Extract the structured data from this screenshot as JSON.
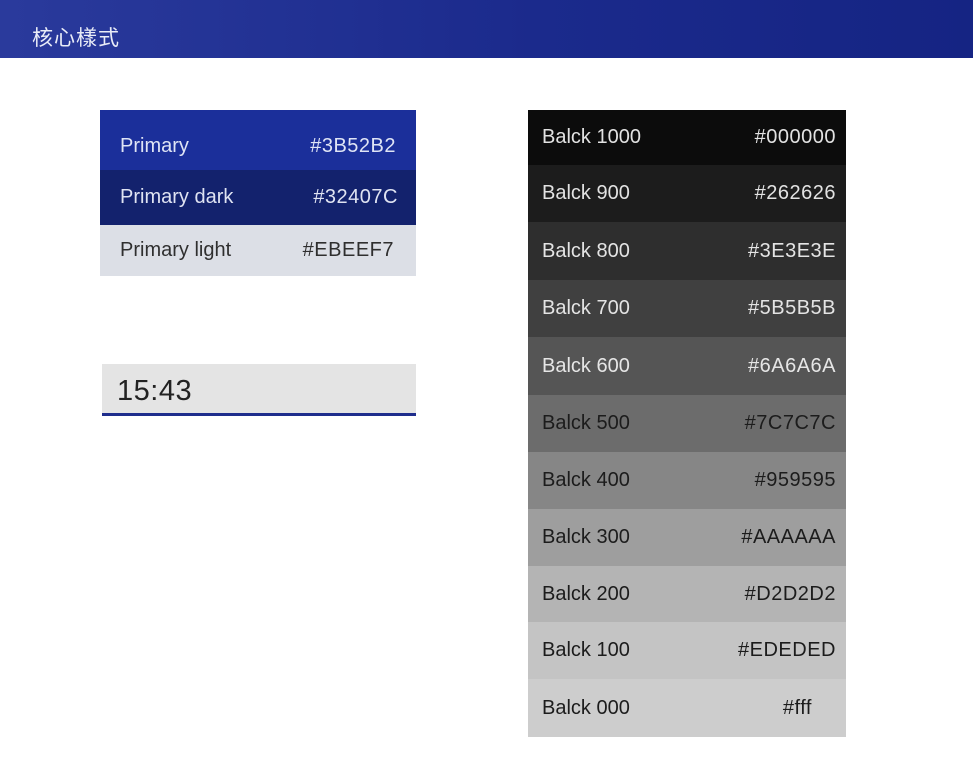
{
  "header": {
    "title": "核心樣式"
  },
  "primary": [
    {
      "name": "Primary",
      "hex": "#3B52B2",
      "bg": "#1b2f9a",
      "fg": "#dfe4f5"
    },
    {
      "name": "Primary  dark",
      "hex": "#32407C",
      "bg": "#13226d",
      "fg": "#dfe3f2"
    },
    {
      "name": "Primary  light",
      "hex": "#EBEEF7",
      "bg": "#dcdfe6",
      "fg": "#2f2f2f"
    }
  ],
  "time_bar": {
    "time": "15:43"
  },
  "grays": [
    {
      "name": "Balck 1000",
      "hex": "#000000",
      "bg": "#0c0c0c",
      "fg": "#e2e2e2"
    },
    {
      "name": "Balck 900",
      "hex": "#262626",
      "bg": "#1c1c1c",
      "fg": "#e2e2e2"
    },
    {
      "name": "Balck 800",
      "hex": "#3E3E3E",
      "bg": "#2e2e2e",
      "fg": "#e4e4e4"
    },
    {
      "name": "Balck 700",
      "hex": "#5B5B5B",
      "bg": "#404040",
      "fg": "#e4e4e4"
    },
    {
      "name": "Balck 600",
      "hex": "#6A6A6A",
      "bg": "#555555",
      "fg": "#e6e6e6"
    },
    {
      "name": "Balck 500",
      "hex": "#7C7C7C",
      "bg": "#6c6c6c",
      "fg": "#1c1c1c"
    },
    {
      "name": "Balck 400",
      "hex": "#959595",
      "bg": "#868686",
      "fg": "#1c1c1c"
    },
    {
      "name": "Balck 300",
      "hex": "#AAAAAA",
      "bg": "#9e9e9e",
      "fg": "#1c1c1c"
    },
    {
      "name": "Balck 200",
      "hex": "#D2D2D2",
      "bg": "#b4b4b4",
      "fg": "#1c1c1c"
    },
    {
      "name": "Balck 100",
      "hex": "#EDEDED",
      "bg": "#c4c4c4",
      "fg": "#1c1c1c"
    },
    {
      "name": "Balck 000",
      "hex": "#fff",
      "bg": "#cdcdcd",
      "fg": "#1c1c1c"
    }
  ]
}
